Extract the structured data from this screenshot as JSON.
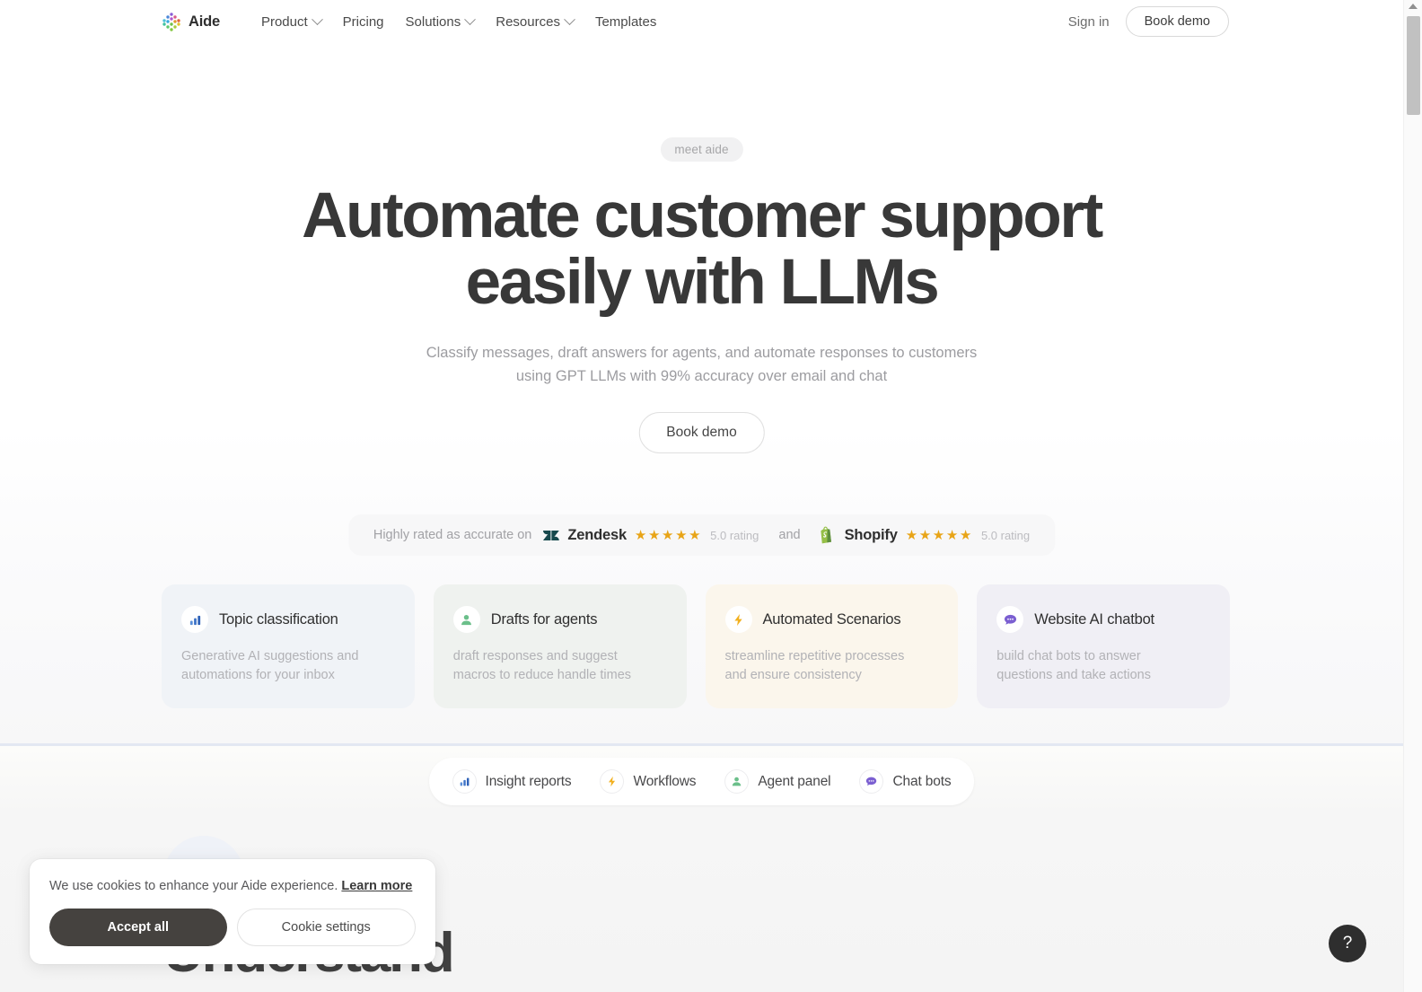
{
  "nav": {
    "brand": {
      "name": "Aide",
      "icon": "aide-dots-logo"
    },
    "items": [
      {
        "label": "Product",
        "has_caret": true
      },
      {
        "label": "Pricing",
        "has_caret": false
      },
      {
        "label": "Solutions",
        "has_caret": true
      },
      {
        "label": "Resources",
        "has_caret": true
      },
      {
        "label": "Templates",
        "has_caret": false
      }
    ],
    "signin_label": "Sign in",
    "demo_label": "Book demo"
  },
  "hero": {
    "eyebrow": "meet aide",
    "headline_line1": "Automate customer support",
    "headline_line2": "easily with LLMs",
    "subhead_line1": "Classify messages, draft answers for agents, and automate responses",
    "subhead_line2": "to customers using GPT LLMs with 99% accuracy over email and chat",
    "cta_label": "Book demo"
  },
  "rating": {
    "lead": "Highly rated as accurate on",
    "conjunction": "and",
    "vendors": [
      {
        "name": "Zendesk",
        "stars": "★★★★★",
        "value": "5.0 rating",
        "icon": "zendesk-logo"
      },
      {
        "name": "Shopify",
        "stars": "★★★★★",
        "value": "5.0 rating",
        "icon": "shopify-logo"
      }
    ],
    "star_color": "#e8a417"
  },
  "cards": [
    {
      "title": "Topic classification",
      "desc": "Generative AI suggestions and automations for your inbox",
      "icon": "bar-chart-icon",
      "icon_color": "#4a7fd4",
      "bg": "#f0f3f7"
    },
    {
      "title": "Drafts for agents",
      "desc": "draft responses and suggest macros to reduce handle times",
      "icon": "person-icon",
      "icon_color": "#6bbf8a",
      "bg": "#eff2ef"
    },
    {
      "title": "Automated Scenarios",
      "desc": "streamline repetitive processes and ensure consistency",
      "icon": "lightning-bolt-icon",
      "icon_color": "#f2b01e",
      "bg": "#fbf6ec"
    },
    {
      "title": "Website AI chatbot",
      "desc": "build chat bots to answer questions and take actions",
      "icon": "chat-bubble-icon",
      "icon_color": "#7b5fd1",
      "bg": "#f0eff5"
    }
  ],
  "tabs": [
    {
      "label": "Insight reports",
      "icon": "bar-chart-icon",
      "icon_color": "#4a7fd4"
    },
    {
      "label": "Workflows",
      "icon": "lightning-bolt-icon",
      "icon_color": "#f2b01e"
    },
    {
      "label": "Agent panel",
      "icon": "person-icon",
      "icon_color": "#6bbf8a"
    },
    {
      "label": "Chat bots",
      "icon": "chat-bubble-icon",
      "icon_color": "#7b5fd1"
    }
  ],
  "section2": {
    "heading": "Understand"
  },
  "cookie": {
    "text": "We use cookies to enhance your Aide experience.",
    "link_label": "Learn more",
    "accept_label": "Accept all",
    "settings_label": "Cookie settings"
  },
  "help": {
    "label": "?"
  }
}
